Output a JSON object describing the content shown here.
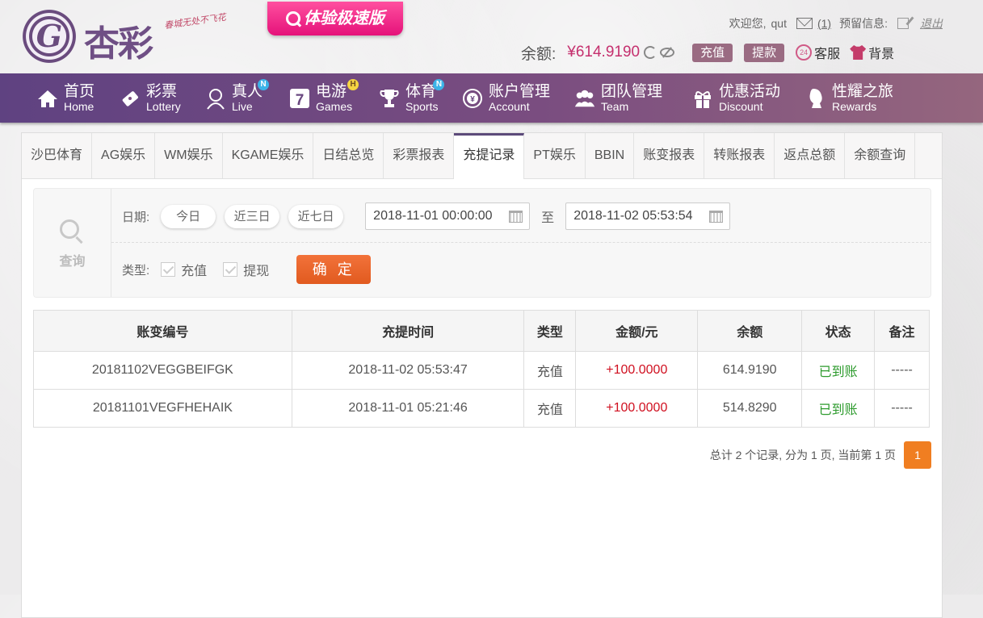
{
  "header": {
    "logo_text": "杏彩",
    "slogan": "春城无处不飞花",
    "promo_label": "体验极速版",
    "welcome": "欢迎您,",
    "username": "qut",
    "message_count": "(1)",
    "notice_label": "预留信息:",
    "logout": "退出",
    "balance_label": "余额:",
    "balance_value": "¥614.9190",
    "deposit_button": "充值",
    "withdraw_button": "提款",
    "service_label": "客服",
    "background_label": "背景",
    "accent_color": "#c5306e"
  },
  "nav": {
    "items": [
      {
        "cn": "首页",
        "en": "Home",
        "icon": "home-icon"
      },
      {
        "cn": "彩票",
        "en": "Lottery",
        "icon": "ticket-icon"
      },
      {
        "cn": "真人",
        "en": "Live",
        "icon": "dealer-icon",
        "badge": "N"
      },
      {
        "cn": "电游",
        "en": "Games",
        "icon": "slot-icon",
        "badge": "H"
      },
      {
        "cn": "体育",
        "en": "Sports",
        "icon": "trophy-icon",
        "badge": "N"
      },
      {
        "cn": "账户管理",
        "en": "Account",
        "icon": "coin-icon"
      },
      {
        "cn": "团队管理",
        "en": "Team",
        "icon": "team-icon"
      },
      {
        "cn": "优惠活动",
        "en": "Discount",
        "icon": "gift-icon"
      },
      {
        "cn": "性耀之旅",
        "en": "Rewards",
        "icon": "rewards-icon"
      }
    ]
  },
  "tabs": [
    "沙巴体育",
    "AG娱乐",
    "WM娱乐",
    "KGAME娱乐",
    "日结总览",
    "彩票报表",
    "充提记录",
    "PT娱乐",
    "BBIN",
    "账变报表",
    "转账报表",
    "返点总额",
    "余额查询"
  ],
  "active_tab": "充提记录",
  "filter": {
    "query_label": "查询",
    "date_label": "日期:",
    "today": "今日",
    "three_days": "近三日",
    "seven_days": "近七日",
    "start_date": "2018-11-01 00:00:00",
    "to_label": "至",
    "end_date": "2018-11-02 05:53:54",
    "type_label": "类型:",
    "type_deposit": "充值",
    "type_withdraw": "提现",
    "confirm_button": "确 定"
  },
  "table": {
    "headers": [
      "账变编号",
      "充提时间",
      "类型",
      "金额/元",
      "余额",
      "状态",
      "备注"
    ],
    "rows": [
      [
        "20181102VEGGBEIFGK",
        "2018-11-02 05:53:47",
        "充值",
        "+100.0000",
        "614.9190",
        "已到账",
        "-----"
      ],
      [
        "20181101VEGFHEHAIK",
        "2018-11-01 05:21:46",
        "充值",
        "+100.0000",
        "514.8290",
        "已到账",
        "-----"
      ]
    ]
  },
  "pagination": {
    "summary": "总计 2 个记录, 分为 1 页, 当前第 1 页",
    "current_page": "1"
  }
}
